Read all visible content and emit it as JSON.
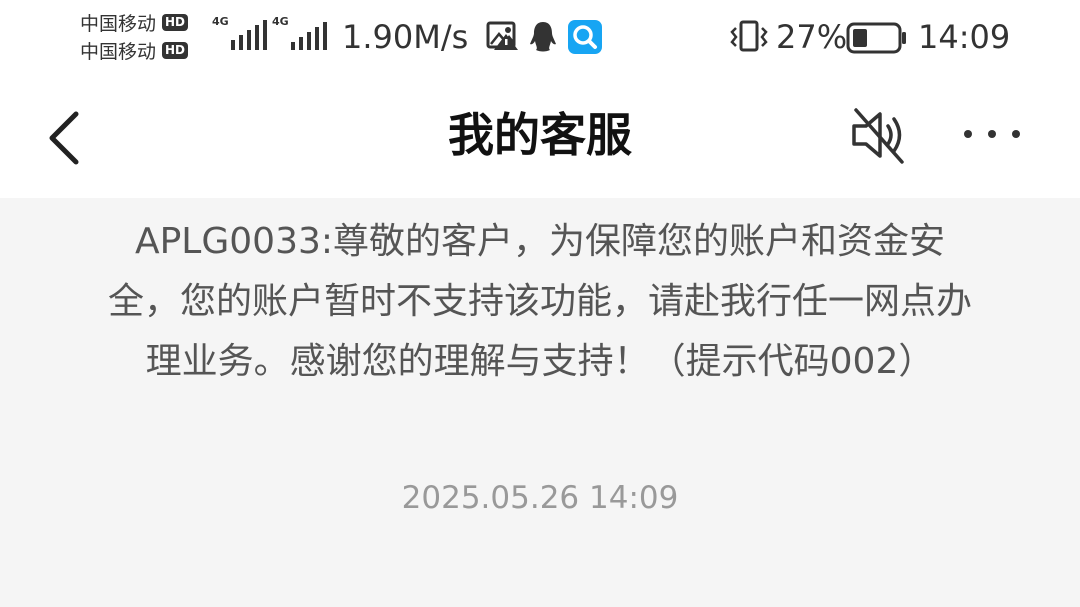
{
  "status_bar": {
    "carriers": [
      {
        "name": "中国移动",
        "badge": "HD"
      },
      {
        "name": "中国移动",
        "badge": "HD"
      }
    ],
    "signal_tags": [
      "4G",
      "4G"
    ],
    "network_speed": "1.90M/s",
    "battery_percent": "27%",
    "time": "14:09",
    "icons": [
      "image-alert-icon",
      "qq-penguin-icon",
      "search-app-icon",
      "vibrate-icon",
      "battery-icon"
    ]
  },
  "header": {
    "title": "我的客服",
    "back_icon": "back-arrow-icon",
    "mute_icon": "speaker-muted-icon",
    "more_icon": "more-dots-icon"
  },
  "message": {
    "text": "APLG0033:尊敬的客户，为保障您的账户和资金安全，您的账户暂时不支持该功能，请赴我行任一网点办理业务。感谢您的理解与支持！（提示代码002）",
    "timestamp": "2025.05.26 14:09"
  }
}
